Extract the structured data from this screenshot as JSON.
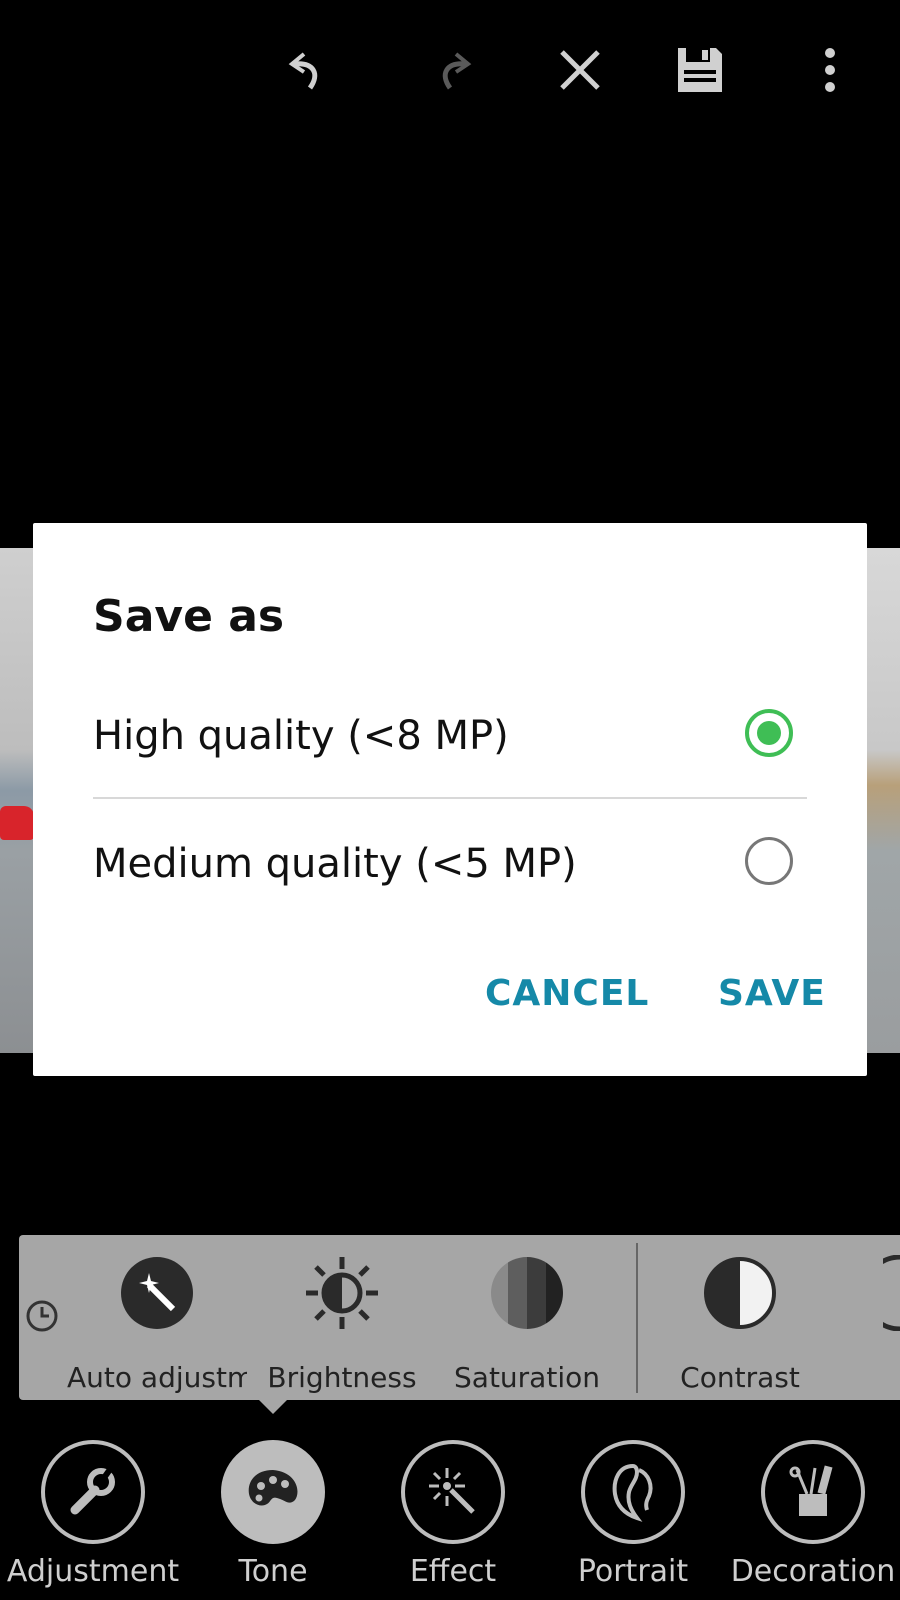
{
  "toolbar": {
    "undo_icon": "undo-icon",
    "redo_icon": "redo-icon",
    "close_icon": "close-icon",
    "save_icon": "save-icon",
    "more_icon": "more-vert-icon"
  },
  "dialog": {
    "title": "Save as",
    "options": [
      {
        "label": "High quality (<8 MP)",
        "selected": true
      },
      {
        "label": "Medium quality (<5 MP)",
        "selected": false
      }
    ],
    "cancel_label": "CANCEL",
    "save_label": "SAVE",
    "accent_color": "#1589a8",
    "radio_color": "#3fbe55"
  },
  "tone_panel": {
    "tools": [
      {
        "label": "Auto adjustm",
        "icon": "magic-wand-icon"
      },
      {
        "label": "Brightness",
        "icon": "brightness-icon"
      },
      {
        "label": "Saturation",
        "icon": "saturation-icon"
      },
      {
        "label": "Contrast",
        "icon": "contrast-icon"
      }
    ]
  },
  "bottom_nav": {
    "items": [
      {
        "label": "Adjustment",
        "icon": "wrench-icon",
        "active": false
      },
      {
        "label": "Tone",
        "icon": "palette-icon",
        "active": true
      },
      {
        "label": "Effect",
        "icon": "magic-sparkle-icon",
        "active": false
      },
      {
        "label": "Portrait",
        "icon": "face-profile-icon",
        "active": false
      },
      {
        "label": "Decoration",
        "icon": "scissors-cup-icon",
        "active": false
      }
    ]
  }
}
